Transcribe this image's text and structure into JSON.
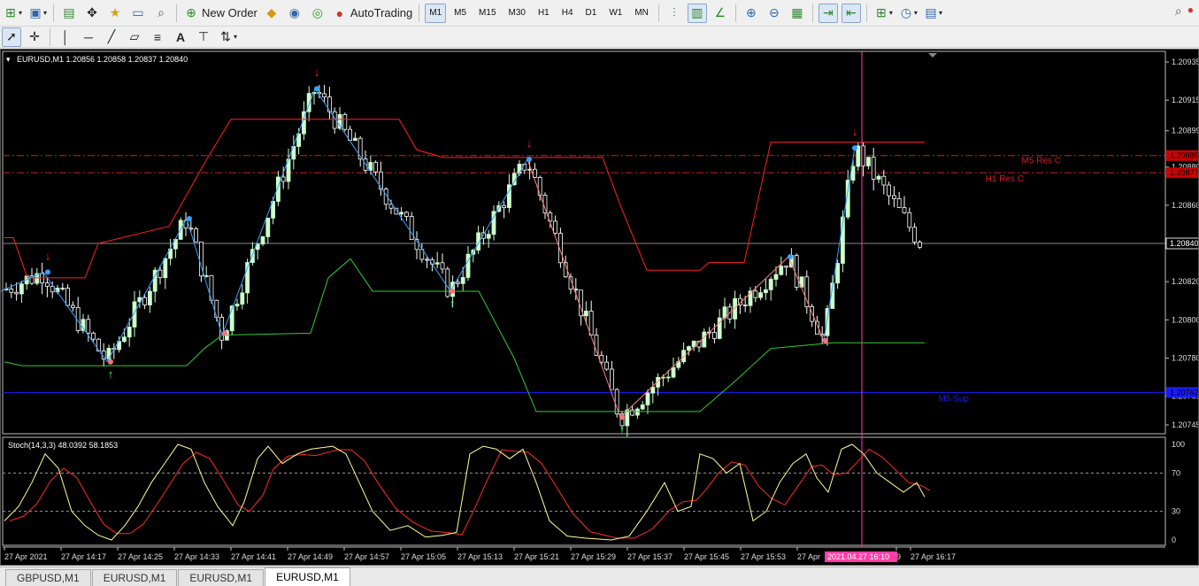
{
  "toolbar1": {
    "new_order": "New Order",
    "autotrading": "AutoTrading",
    "timeframes": [
      "M1",
      "M5",
      "M15",
      "M30",
      "H1",
      "H4",
      "D1",
      "W1",
      "MN"
    ],
    "active_timeframe": "M1"
  },
  "chart": {
    "header": "EURUSD,M1  1.20856 1.20858 1.20837 1.20840",
    "price_labels": [
      "1.20935",
      "1.20915",
      "1.20899",
      "1.20880",
      "1.20860",
      "1.20840",
      "1.20820",
      "1.20800",
      "1.20780",
      "1.20760",
      "1.20745"
    ],
    "level_tags": [
      "1.20886",
      "1.20877",
      "1.20840",
      "1.20762"
    ],
    "lines": {
      "m5_res": "M5 Res C",
      "h1_res": "H1 Res C",
      "m5_sup": "M5 Sup"
    },
    "colors": {
      "bull": "#ccffcc",
      "bear": "#ffffff",
      "upper_band": "#ff2020",
      "lower_band": "#33cc33",
      "zigzag": "#3aa0ff",
      "resistance": "#cc2020",
      "support": "#1a1aff",
      "cursor": "#ff3da6"
    }
  },
  "stoch": {
    "header": "Stoch(14,3,3) 48.0392 58.1853",
    "levels": [
      "100",
      "70",
      "30",
      "0"
    ]
  },
  "time_axis": {
    "labels": [
      "27 Apr 2021",
      "27 Apr 14:17",
      "27 Apr 14:25",
      "27 Apr 14:33",
      "27 Apr 14:41",
      "27 Apr 14:49",
      "27 Apr 14:57",
      "27 Apr 15:05",
      "27 Apr 15:13",
      "27 Apr 15:21",
      "27 Apr 15:29",
      "27 Apr 15:37",
      "27 Apr 15:45",
      "27 Apr 15:53",
      "27 Apr",
      "9",
      "27 Apr 16:17"
    ],
    "cursor_label": "2021.04.27 16:10"
  },
  "tabs": [
    "GBPUSD,M1",
    "EURUSD,M1",
    "EURUSD,M1",
    "EURUSD,M1"
  ],
  "active_tab_index": 3
}
